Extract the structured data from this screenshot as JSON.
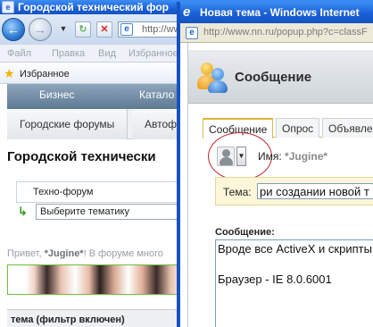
{
  "background_window": {
    "title": "Городской технический фор",
    "address": "http://ww",
    "menu": [
      "Файл",
      "Правка",
      "Вид",
      "Избранное"
    ],
    "favorites_label": "Избранное",
    "site_nav": [
      "Бизнес",
      "Катало"
    ],
    "site_tabs": [
      "Городские форумы",
      "Автофо"
    ],
    "heading": "Городской технически",
    "forum_name": "Техно-форум",
    "theme_select": "Выберите тематику",
    "greeting_prefix": "Привет, ",
    "greeting_user": "*Jugine*",
    "greeting_suffix": "! В форуме много",
    "filter_label": "тема (фильтр включен)"
  },
  "popup": {
    "title": "Новая тема - Windows Internet",
    "address": "http://www.nn.ru/popup.php?c=classF",
    "header_title": "Сообщение",
    "tabs": [
      "Сообщение",
      "Опрос",
      "Объявле"
    ],
    "name_label": "Имя: ",
    "name_value": "*Jugine*",
    "theme_label": "Тема:",
    "theme_value": "ри создании новой т",
    "message_label": "Сообщение:",
    "message_line1": "Вроде все ActiveX и скрипты",
    "message_line2": "Браузер - IE 8.0.6001"
  },
  "colors": {
    "titlebar": "#1a5fd6",
    "highlight_circle": "#c0282d",
    "theme_row_bg": "#fdf6d8"
  }
}
